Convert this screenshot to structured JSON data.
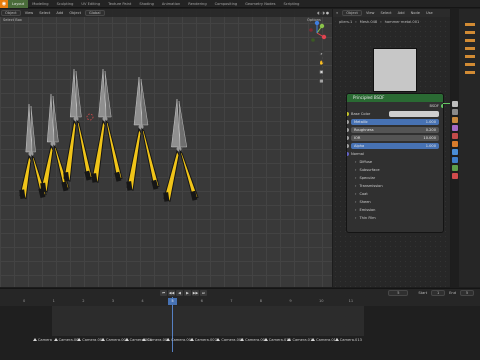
{
  "app": {
    "logo": "blender-icon"
  },
  "workspaces": [
    "Layout",
    "Modeling",
    "Sculpting",
    "UV Editing",
    "Texture Paint",
    "Shading",
    "Animation",
    "Rendering",
    "Compositing",
    "Geometry Nodes",
    "Scripting"
  ],
  "viewport": {
    "header": {
      "mode": "Object",
      "menus": [
        "View",
        "Select",
        "Add",
        "Object"
      ],
      "orientation": "Global",
      "options": "Options"
    },
    "left_label": "Object",
    "second_row_left": "Select Box"
  },
  "node_editor": {
    "header": {
      "type": "Object",
      "menus": [
        "View",
        "Select",
        "Add",
        "Node"
      ],
      "slot": "Use"
    },
    "breadcrumb": [
      "pliers.1",
      "Mesh.048",
      "hammer metal.001"
    ],
    "node": {
      "title": "Principled BSDF",
      "output": "BSDF",
      "base_color_label": "Base Color",
      "rows": [
        {
          "label": "Metallic",
          "value": "1.000",
          "style": "blue"
        },
        {
          "label": "Roughness",
          "value": "0.200",
          "style": "gray"
        },
        {
          "label": "IOR",
          "value": "10.000",
          "style": "gray"
        },
        {
          "label": "Alpha",
          "value": "1.000",
          "style": "blue"
        }
      ],
      "normal_label": "Normal",
      "sections": [
        "Diffuse",
        "Subsurface",
        "Specular",
        "Transmission",
        "Coat",
        "Sheen",
        "Emission",
        "Thin Film"
      ]
    }
  },
  "timeline": {
    "current_frame": "5",
    "start_label": "Start",
    "start_value": "1",
    "end_label": "End",
    "end_value": "5",
    "ruler": [
      "0",
      "1",
      "2",
      "3",
      "4",
      "5",
      "6",
      "7",
      "8",
      "9",
      "10",
      "11"
    ],
    "playback_buttons": [
      "⏮",
      "◀◀",
      "◀",
      "▶",
      "▶▶",
      "⏭"
    ]
  },
  "markers": [
    {
      "label": "Camera",
      "frame": 0.3
    },
    {
      "label": "Camera.001",
      "frame": 1.0
    },
    {
      "label": "Camera.002",
      "frame": 1.8
    },
    {
      "label": "Camera.003",
      "frame": 2.6
    },
    {
      "label": "Camera.004",
      "frame": 3.4
    },
    {
      "label": "Camera.005",
      "frame": 4.0
    },
    {
      "label": "Camera.006",
      "frame": 4.8
    },
    {
      "label": "Camera.007",
      "frame": 5.6
    },
    {
      "label": "Camera.008",
      "frame": 6.5
    },
    {
      "label": "Camera.009",
      "frame": 7.3
    },
    {
      "label": "Camera.010",
      "frame": 8.1
    },
    {
      "label": "Camera.011",
      "frame": 8.9
    },
    {
      "label": "Camera.012",
      "frame": 9.7
    },
    {
      "label": "Camera.013",
      "frame": 10.5
    }
  ],
  "colors": {
    "accent": "#4772b3",
    "node_header": "#2a6a33",
    "pliers_yellow": "#f0c419",
    "handle_black": "#161616"
  }
}
